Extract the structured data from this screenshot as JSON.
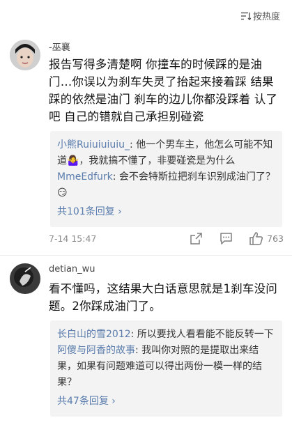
{
  "sort": {
    "label": "按热度"
  },
  "comments": [
    {
      "username": "-巫襄",
      "text": "报告写得多清楚啊 你撞车的时候踩的是油门…你误以为刹车失灵了抬起来接着踩 结果踩的依然是油门 刹车的边儿你都没踩着 认了吧 自己的错就自己承担别碰瓷",
      "replies": [
        {
          "name": "小熊Ruiuiuiuiu_",
          "text": ": 他一个男车主，他怎么可能不知道",
          "emoji": "🤷‍♀️",
          "text2": "，我就搞不懂了，非要碰瓷是为什么"
        },
        {
          "name": "MmeEdfurk",
          "text": ": 会不会特斯拉把刹车识别成油门了？",
          "emoji": "😏"
        }
      ],
      "more": "共101条回复 ›",
      "time": "7-14 15:47",
      "likes": "763"
    },
    {
      "username": "detian_wu",
      "text": "看不懂吗，这结果大白话意思就是1刹车没问题。2你踩成油门了。",
      "replies": [
        {
          "name": "长白山的雪2012",
          "text": ": 所以要找人看看能不能反转一下"
        },
        {
          "name": "阿傻与阿香的故事",
          "text": ": 我叫你对照的是提取出来结果，如果有问题难道可以得出两份一模一样的结果？"
        }
      ],
      "more": "共47条回复 ›"
    }
  ]
}
